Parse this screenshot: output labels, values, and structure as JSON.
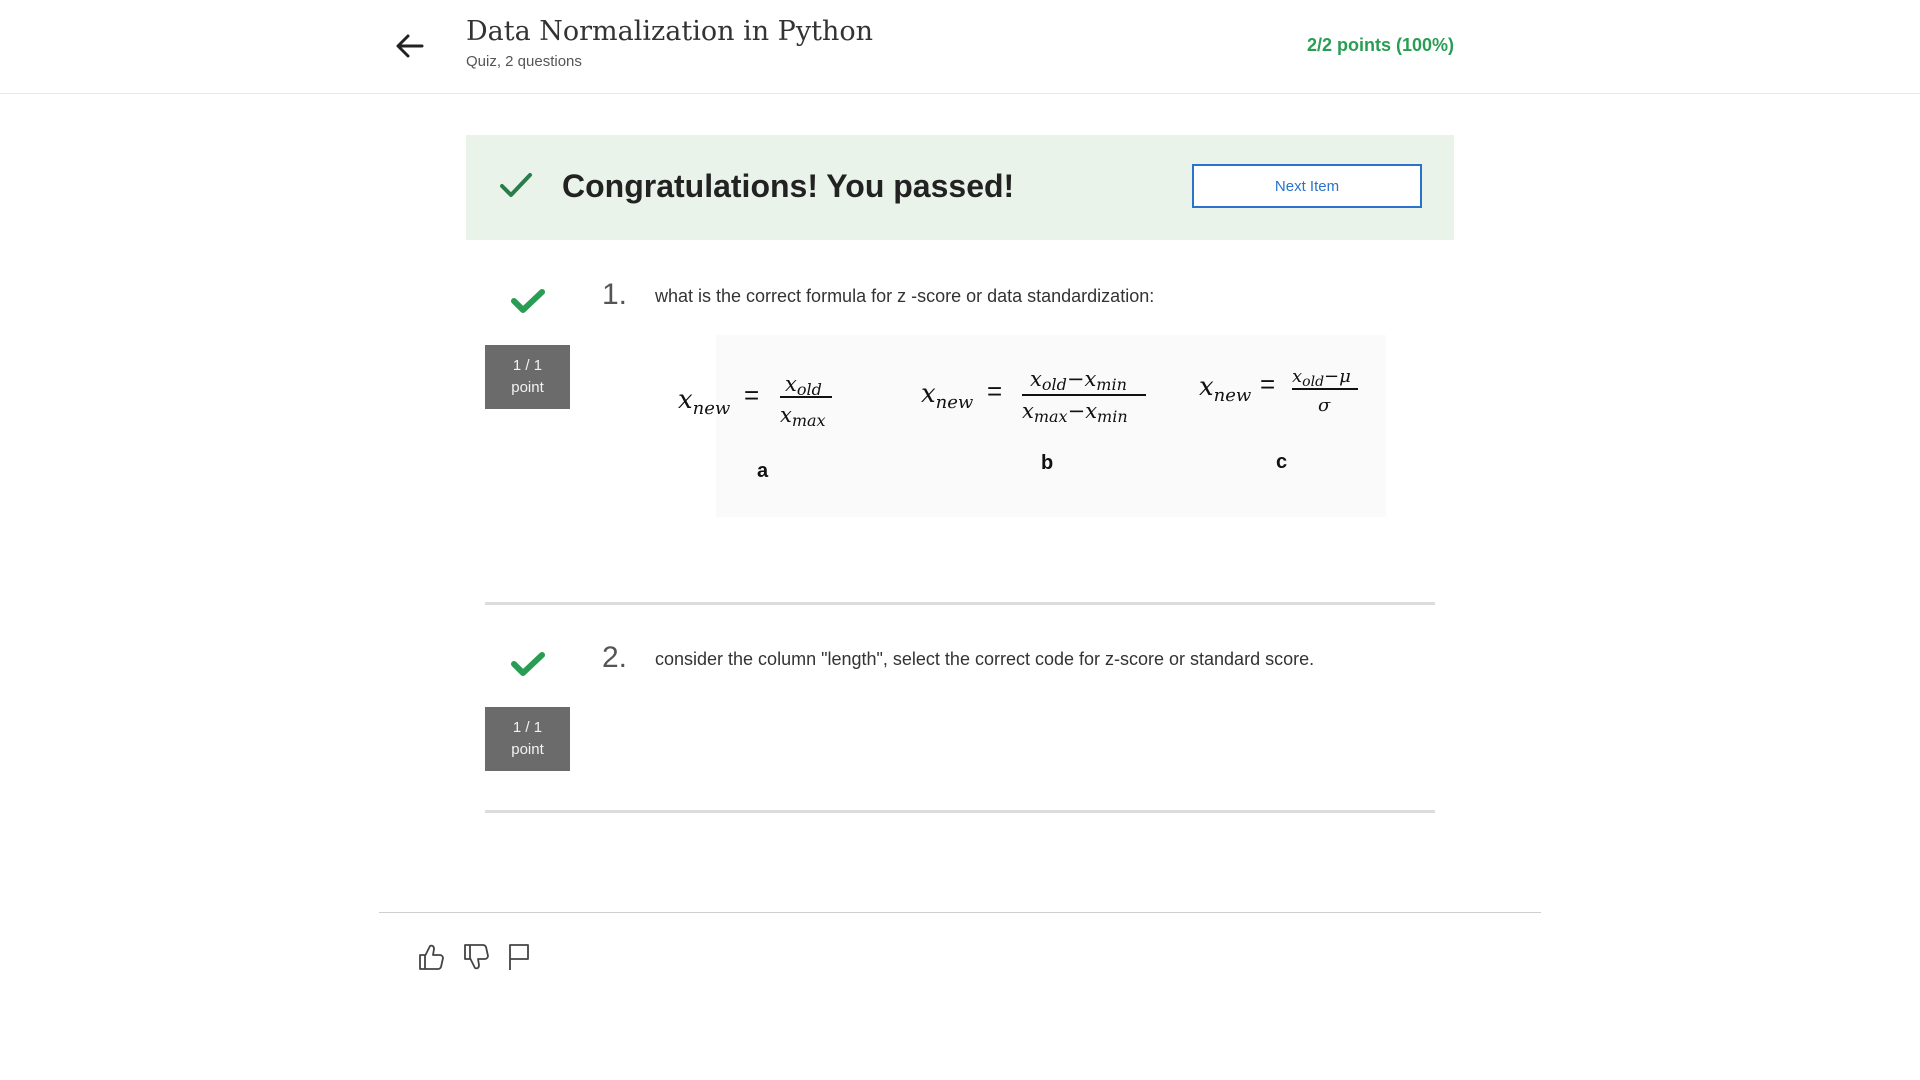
{
  "header": {
    "title": "Data Normalization in Python",
    "subtitle": "Quiz, 2 questions",
    "points": "2/2 points (100%)"
  },
  "banner": {
    "message": "Congratulations! You passed!",
    "next_button": "Next Item"
  },
  "questions": [
    {
      "number": "1.",
      "text": "what is the correct formula for z -score or data standardization:",
      "score": "1 / 1",
      "score_unit": "point",
      "formulas": [
        {
          "label": "a",
          "lhs": "x",
          "lhs_sub": "new",
          "num": "x",
          "num_sub": "old",
          "den": "x",
          "den_sub": "max"
        },
        {
          "label": "b",
          "lhs": "x",
          "lhs_sub": "new",
          "num": "x",
          "num_sub": "old",
          "num_op": "−",
          "num2": "x",
          "num2_sub": "min",
          "den": "x",
          "den_sub": "max",
          "den_op": "−",
          "den2": "x",
          "den2_sub": "min"
        },
        {
          "label": "c",
          "lhs": "x",
          "lhs_sub": "new",
          "num": "x",
          "num_sub": "old",
          "num_op": "−",
          "num2": "μ",
          "den": "σ"
        }
      ]
    },
    {
      "number": "2.",
      "text": "consider the column \"length\", select the correct code for z-score or standard score.",
      "score": "1 / 1",
      "score_unit": "point"
    }
  ],
  "colors": {
    "accent_green": "#2a9d54",
    "banner_bg": "#eaf3ea",
    "button_blue": "#2a73cc",
    "score_box": "#6b6b6b"
  },
  "icons": [
    "arrow-left-icon",
    "checkmark-icon",
    "thumbs-up-icon",
    "thumbs-down-icon",
    "flag-icon"
  ]
}
